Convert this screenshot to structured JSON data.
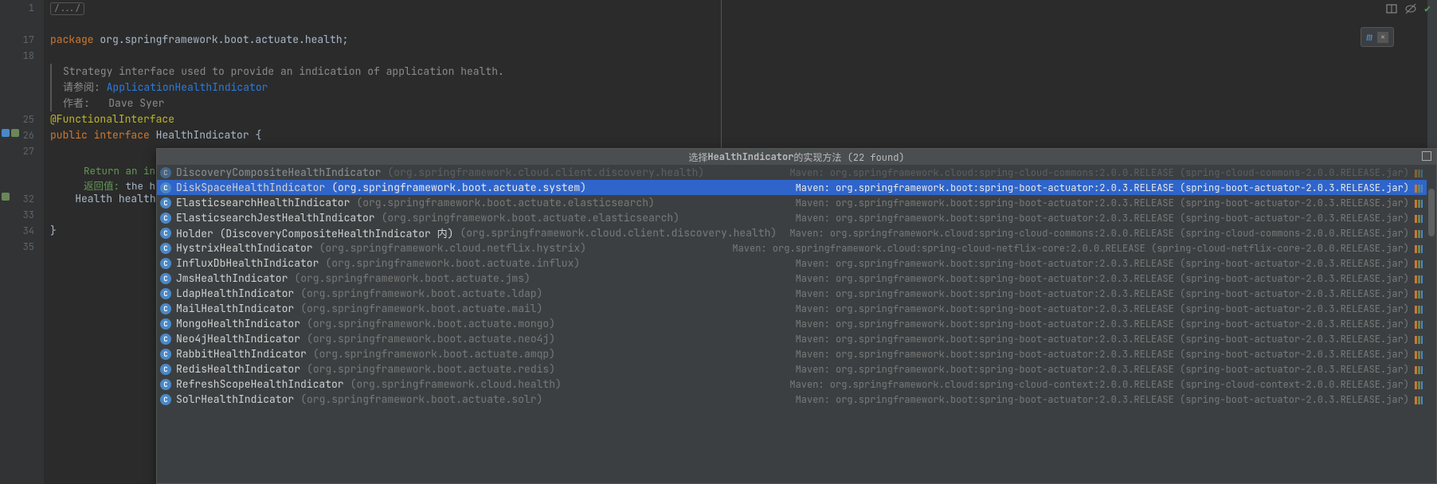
{
  "gutter_lines": [
    "1",
    "",
    "17",
    "18",
    "",
    "",
    "",
    "25",
    "26",
    "27",
    "",
    "",
    "32",
    "33",
    "34",
    "35"
  ],
  "code": {
    "fold_label": "/.../",
    "package_kw": "package",
    "package_name": "org.springframework.boot.actuate.health",
    "javadoc_line1": "Strategy interface used to provide an indication of application health.",
    "javadoc_see_label": "请参阅:",
    "javadoc_see_link": "ApplicationHealthIndicator",
    "javadoc_author_label": "作者:",
    "javadoc_author_name": "Dave Syer",
    "annotation": "@FunctionalInterface",
    "public_kw": "public",
    "interface_kw": "interface",
    "interface_name": "HealthIndicator",
    "open_brace": "{",
    "method_return_doc": "Return an indic",
    "method_returns_label": "返回值:",
    "method_returns_text": "the heal",
    "method_decl_type": "Health",
    "method_decl_name": "health(",
    "close_brace": "}"
  },
  "toolbar": {
    "m_icon": "m",
    "close_label": "×"
  },
  "popup": {
    "title_prefix": "选择",
    "title_bold": "HealthIndicator",
    "title_suffix": "的实现方法 (22 found)",
    "items": [
      {
        "class": "DiscoveryCompositeHealthIndicator",
        "pkg": "(org.springframework.cloud.client.discovery.health)",
        "right": "Maven: org.springframework.cloud:spring-cloud-commons:2.0.0.RELEASE (spring-cloud-commons-2.0.0.RELEASE.jar)",
        "faded": true,
        "selected": false
      },
      {
        "class": "DiskSpaceHealthIndicator",
        "pkg": "(org.springframework.boot.actuate.system)",
        "right": "Maven: org.springframework.boot:spring-boot-actuator:2.0.3.RELEASE (spring-boot-actuator-2.0.3.RELEASE.jar)",
        "faded": false,
        "selected": true
      },
      {
        "class": "ElasticsearchHealthIndicator",
        "pkg": "(org.springframework.boot.actuate.elasticsearch)",
        "right": "Maven: org.springframework.boot:spring-boot-actuator:2.0.3.RELEASE (spring-boot-actuator-2.0.3.RELEASE.jar)",
        "faded": false,
        "selected": false
      },
      {
        "class": "ElasticsearchJestHealthIndicator",
        "pkg": "(org.springframework.boot.actuate.elasticsearch)",
        "right": "Maven: org.springframework.boot:spring-boot-actuator:2.0.3.RELEASE (spring-boot-actuator-2.0.3.RELEASE.jar)",
        "faded": false,
        "selected": false
      },
      {
        "class": "Holder (DiscoveryCompositeHealthIndicator 内)",
        "pkg": "(org.springframework.cloud.client.discovery.health)",
        "right": "Maven: org.springframework.cloud:spring-cloud-commons:2.0.0.RELEASE (spring-cloud-commons-2.0.0.RELEASE.jar)",
        "faded": false,
        "selected": false
      },
      {
        "class": "HystrixHealthIndicator",
        "pkg": "(org.springframework.cloud.netflix.hystrix)",
        "right": "Maven: org.springframework.cloud:spring-cloud-netflix-core:2.0.0.RELEASE (spring-cloud-netflix-core-2.0.0.RELEASE.jar)",
        "faded": false,
        "selected": false
      },
      {
        "class": "InfluxDbHealthIndicator",
        "pkg": "(org.springframework.boot.actuate.influx)",
        "right": "Maven: org.springframework.boot:spring-boot-actuator:2.0.3.RELEASE (spring-boot-actuator-2.0.3.RELEASE.jar)",
        "faded": false,
        "selected": false
      },
      {
        "class": "JmsHealthIndicator",
        "pkg": "(org.springframework.boot.actuate.jms)",
        "right": "Maven: org.springframework.boot:spring-boot-actuator:2.0.3.RELEASE (spring-boot-actuator-2.0.3.RELEASE.jar)",
        "faded": false,
        "selected": false
      },
      {
        "class": "LdapHealthIndicator",
        "pkg": "(org.springframework.boot.actuate.ldap)",
        "right": "Maven: org.springframework.boot:spring-boot-actuator:2.0.3.RELEASE (spring-boot-actuator-2.0.3.RELEASE.jar)",
        "faded": false,
        "selected": false
      },
      {
        "class": "MailHealthIndicator",
        "pkg": "(org.springframework.boot.actuate.mail)",
        "right": "Maven: org.springframework.boot:spring-boot-actuator:2.0.3.RELEASE (spring-boot-actuator-2.0.3.RELEASE.jar)",
        "faded": false,
        "selected": false
      },
      {
        "class": "MongoHealthIndicator",
        "pkg": "(org.springframework.boot.actuate.mongo)",
        "right": "Maven: org.springframework.boot:spring-boot-actuator:2.0.3.RELEASE (spring-boot-actuator-2.0.3.RELEASE.jar)",
        "faded": false,
        "selected": false
      },
      {
        "class": "Neo4jHealthIndicator",
        "pkg": "(org.springframework.boot.actuate.neo4j)",
        "right": "Maven: org.springframework.boot:spring-boot-actuator:2.0.3.RELEASE (spring-boot-actuator-2.0.3.RELEASE.jar)",
        "faded": false,
        "selected": false
      },
      {
        "class": "RabbitHealthIndicator",
        "pkg": "(org.springframework.boot.actuate.amqp)",
        "right": "Maven: org.springframework.boot:spring-boot-actuator:2.0.3.RELEASE (spring-boot-actuator-2.0.3.RELEASE.jar)",
        "faded": false,
        "selected": false
      },
      {
        "class": "RedisHealthIndicator",
        "pkg": "(org.springframework.boot.actuate.redis)",
        "right": "Maven: org.springframework.boot:spring-boot-actuator:2.0.3.RELEASE (spring-boot-actuator-2.0.3.RELEASE.jar)",
        "faded": false,
        "selected": false
      },
      {
        "class": "RefreshScopeHealthIndicator",
        "pkg": "(org.springframework.cloud.health)",
        "right": "Maven: org.springframework.cloud:spring-cloud-context:2.0.0.RELEASE (spring-cloud-context-2.0.0.RELEASE.jar)",
        "faded": false,
        "selected": false
      },
      {
        "class": "SolrHealthIndicator",
        "pkg": "(org.springframework.boot.actuate.solr)",
        "right": "Maven: org.springframework.boot:spring-boot-actuator:2.0.3.RELEASE (spring-boot-actuator-2.0.3.RELEASE.jar)",
        "faded": false,
        "selected": false
      }
    ]
  }
}
